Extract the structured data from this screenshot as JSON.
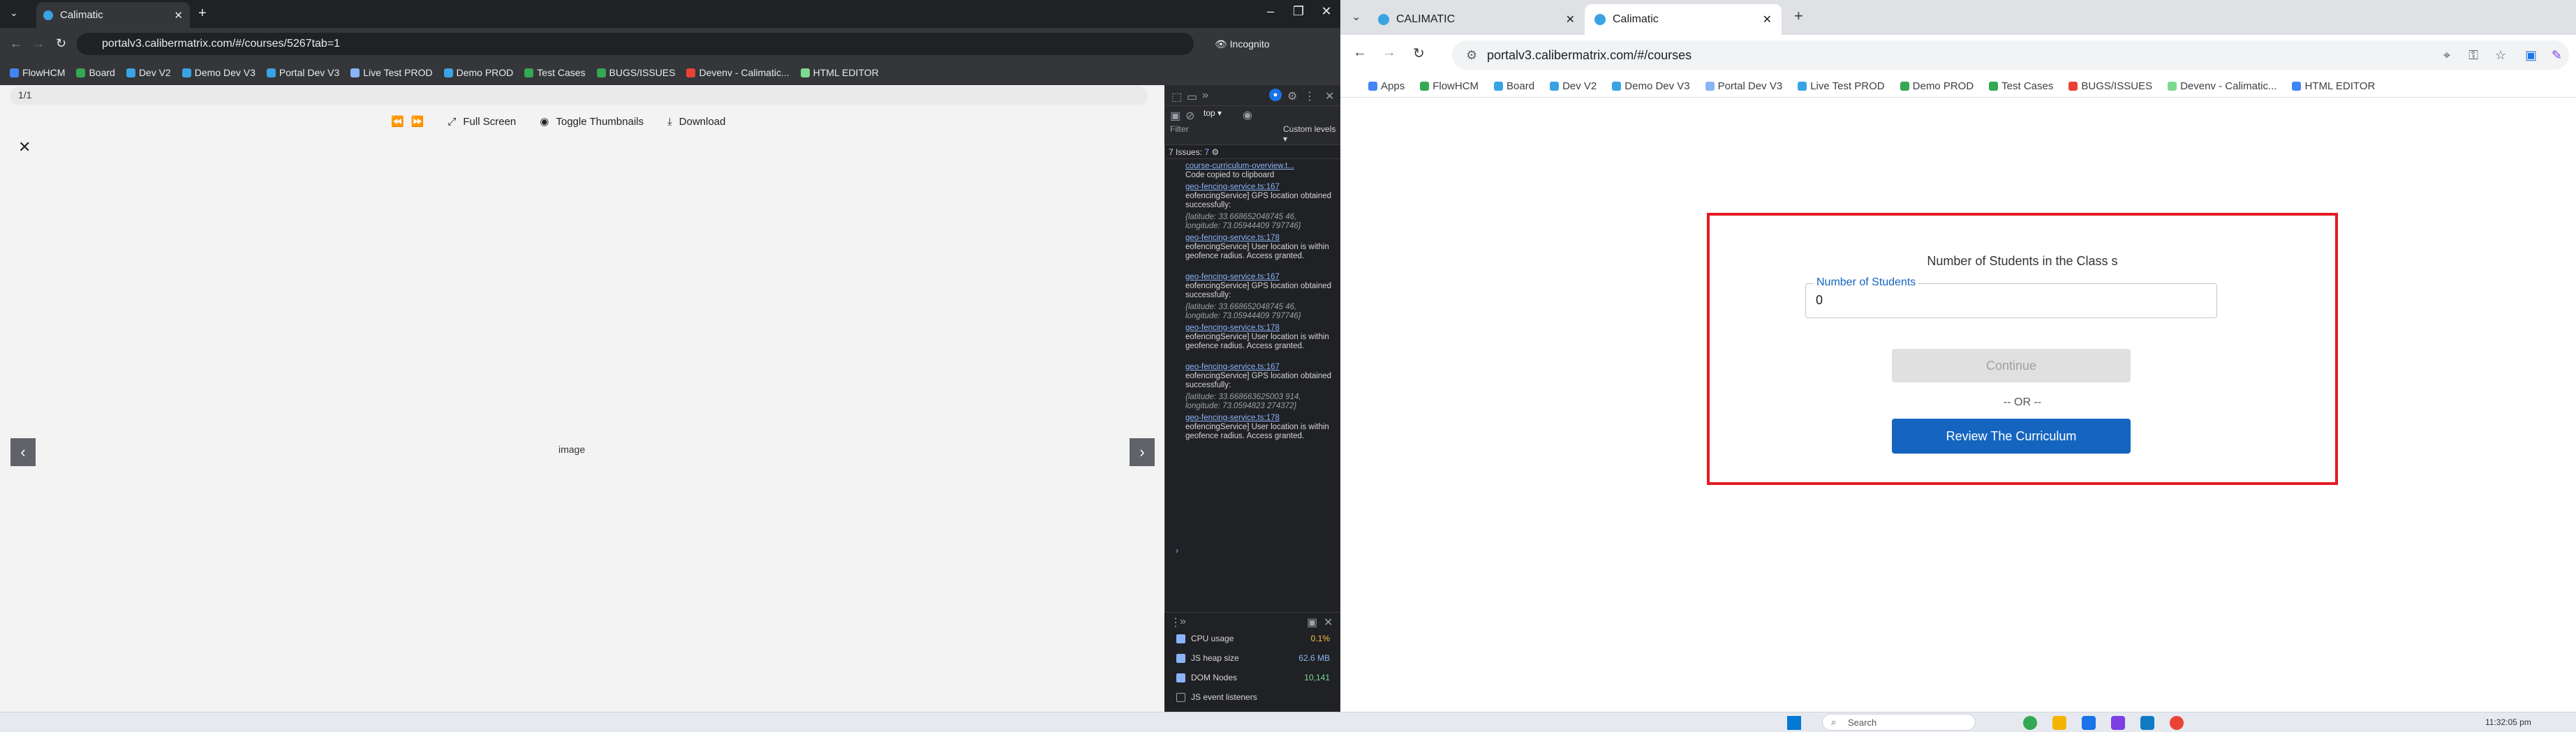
{
  "left_window": {
    "tab_title": "Calimatic",
    "url": "portalv3.calibermatrix.com/#/courses/5267tab=1",
    "incognito_label": "Incognito",
    "bookmarks": [
      "FlowHCM",
      "Board",
      "Dev V2",
      "Demo Dev V3",
      "Portal Dev V3",
      "Live Test PROD",
      "Demo PROD",
      "Test Cases",
      "BUGS/ISSUES",
      "Devenv - Calimatic...",
      "HTML EDITOR"
    ],
    "viewer": {
      "page_indicator": "1/1",
      "full_screen": "Full Screen",
      "toggle_thumbnails": "Toggle Thumbnails",
      "download": "Download",
      "image_alt": "image"
    }
  },
  "devtools": {
    "context": "top",
    "filter_placeholder": "Filter",
    "levels": "Custom levels",
    "issues": "7 Issues:",
    "issues_count": "7",
    "logs": [
      {
        "link": "course-curriculum-overview.t...",
        "text": "Code copied to clipboard"
      },
      {
        "link": "geo-fencing-service.ts:167",
        "text": "eofencingService] GPS location obtained successfully:"
      },
      {
        "link": "",
        "text": "{latitude: 33.668652048745 46, longitude: 73.05944409 797746}"
      },
      {
        "link": "geo-fencing-service.ts:178",
        "text": "eofencingService] User location is within geofence radius. Access granted."
      },
      {
        "link": "geo-fencing-service.ts:167",
        "text": "eofencingService] GPS location obtained successfully:"
      },
      {
        "link": "",
        "text": "{latitude: 33.668652048745 46, longitude: 73.05944409 797746}"
      },
      {
        "link": "geo-fencing-service.ts:178",
        "text": "eofencingService] User location is within geofence radius. Access granted."
      },
      {
        "link": "geo-fencing-service.ts:167",
        "text": "eofencingService] GPS location obtained successfully:"
      },
      {
        "link": "",
        "text": "{latitude: 33.668663625003 914, longitude: 73.0594823 274372}"
      },
      {
        "link": "geo-fencing-service.ts:178",
        "text": "eofencingService] User location is within geofence radius. Access granted."
      }
    ],
    "perf": [
      {
        "label": "CPU usage",
        "value": "0.1%",
        "checked": true,
        "color": "#f7c04a"
      },
      {
        "label": "JS heap size",
        "value": "62.6 MB",
        "checked": true,
        "color": "#8ab4f8"
      },
      {
        "label": "DOM Nodes",
        "value": "10,141",
        "checked": true,
        "color": "#7cd991"
      },
      {
        "label": "JS event listeners",
        "value": "",
        "checked": false,
        "color": "#d6d6d6"
      }
    ]
  },
  "right_window": {
    "tabs": [
      {
        "title": "CALIMATIC",
        "active": false
      },
      {
        "title": "Calimatic",
        "active": true
      }
    ],
    "url": "portalv3.calibermatrix.com/#/courses",
    "bookmarks": [
      "Apps",
      "FlowHCM",
      "Board",
      "Dev V2",
      "Demo Dev V3",
      "Portal Dev V3",
      "Live Test PROD",
      "Demo PROD",
      "Test Cases",
      "BUGS/ISSUES",
      "Devenv - Calimatic...",
      "HTML EDITOR"
    ],
    "modal": {
      "title": "Number of Students in the Class s",
      "field_label": "Number of Students",
      "field_value": "0",
      "continue_label": "Continue",
      "or_text": "-- OR --",
      "review_label": "Review The Curriculum"
    },
    "colors": {
      "primary": "#1565c0",
      "highlight_border": "#e31b23",
      "disabled_bg": "#e0e0e0"
    }
  },
  "taskbar": {
    "search_placeholder": "Search",
    "clock": "11:32:05 pm"
  }
}
